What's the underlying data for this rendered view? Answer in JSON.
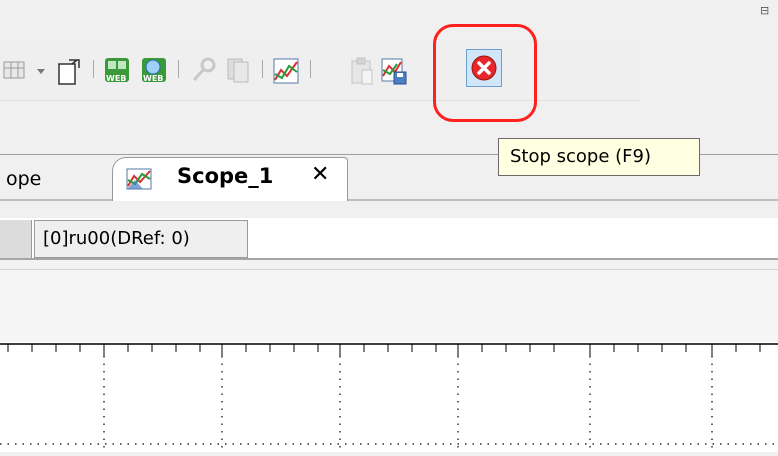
{
  "tooltip": {
    "text": "Stop scope (F9)"
  },
  "tabs": [
    {
      "label": "ope",
      "active": false
    },
    {
      "label": "Scope_1",
      "active": true,
      "close": "✕"
    }
  ],
  "reference": {
    "label": "[0]ru00(DRef: 0)"
  },
  "toolbar": {
    "icons": [
      "table-icon",
      "dropdown-arrow-icon",
      "copy-document-icon",
      "web-add-icon",
      "web-search-icon",
      "key-icon",
      "document-edit-icon",
      "scope-graph-icon",
      "stop-scope-icon",
      "paste-icon",
      "scope-save-icon"
    ],
    "highlighted": "stop-scope-icon"
  },
  "colors": {
    "highlight_ring": "#ff2020",
    "stop_red": "#e8252a",
    "tooltip_bg": "#ffffe1"
  }
}
